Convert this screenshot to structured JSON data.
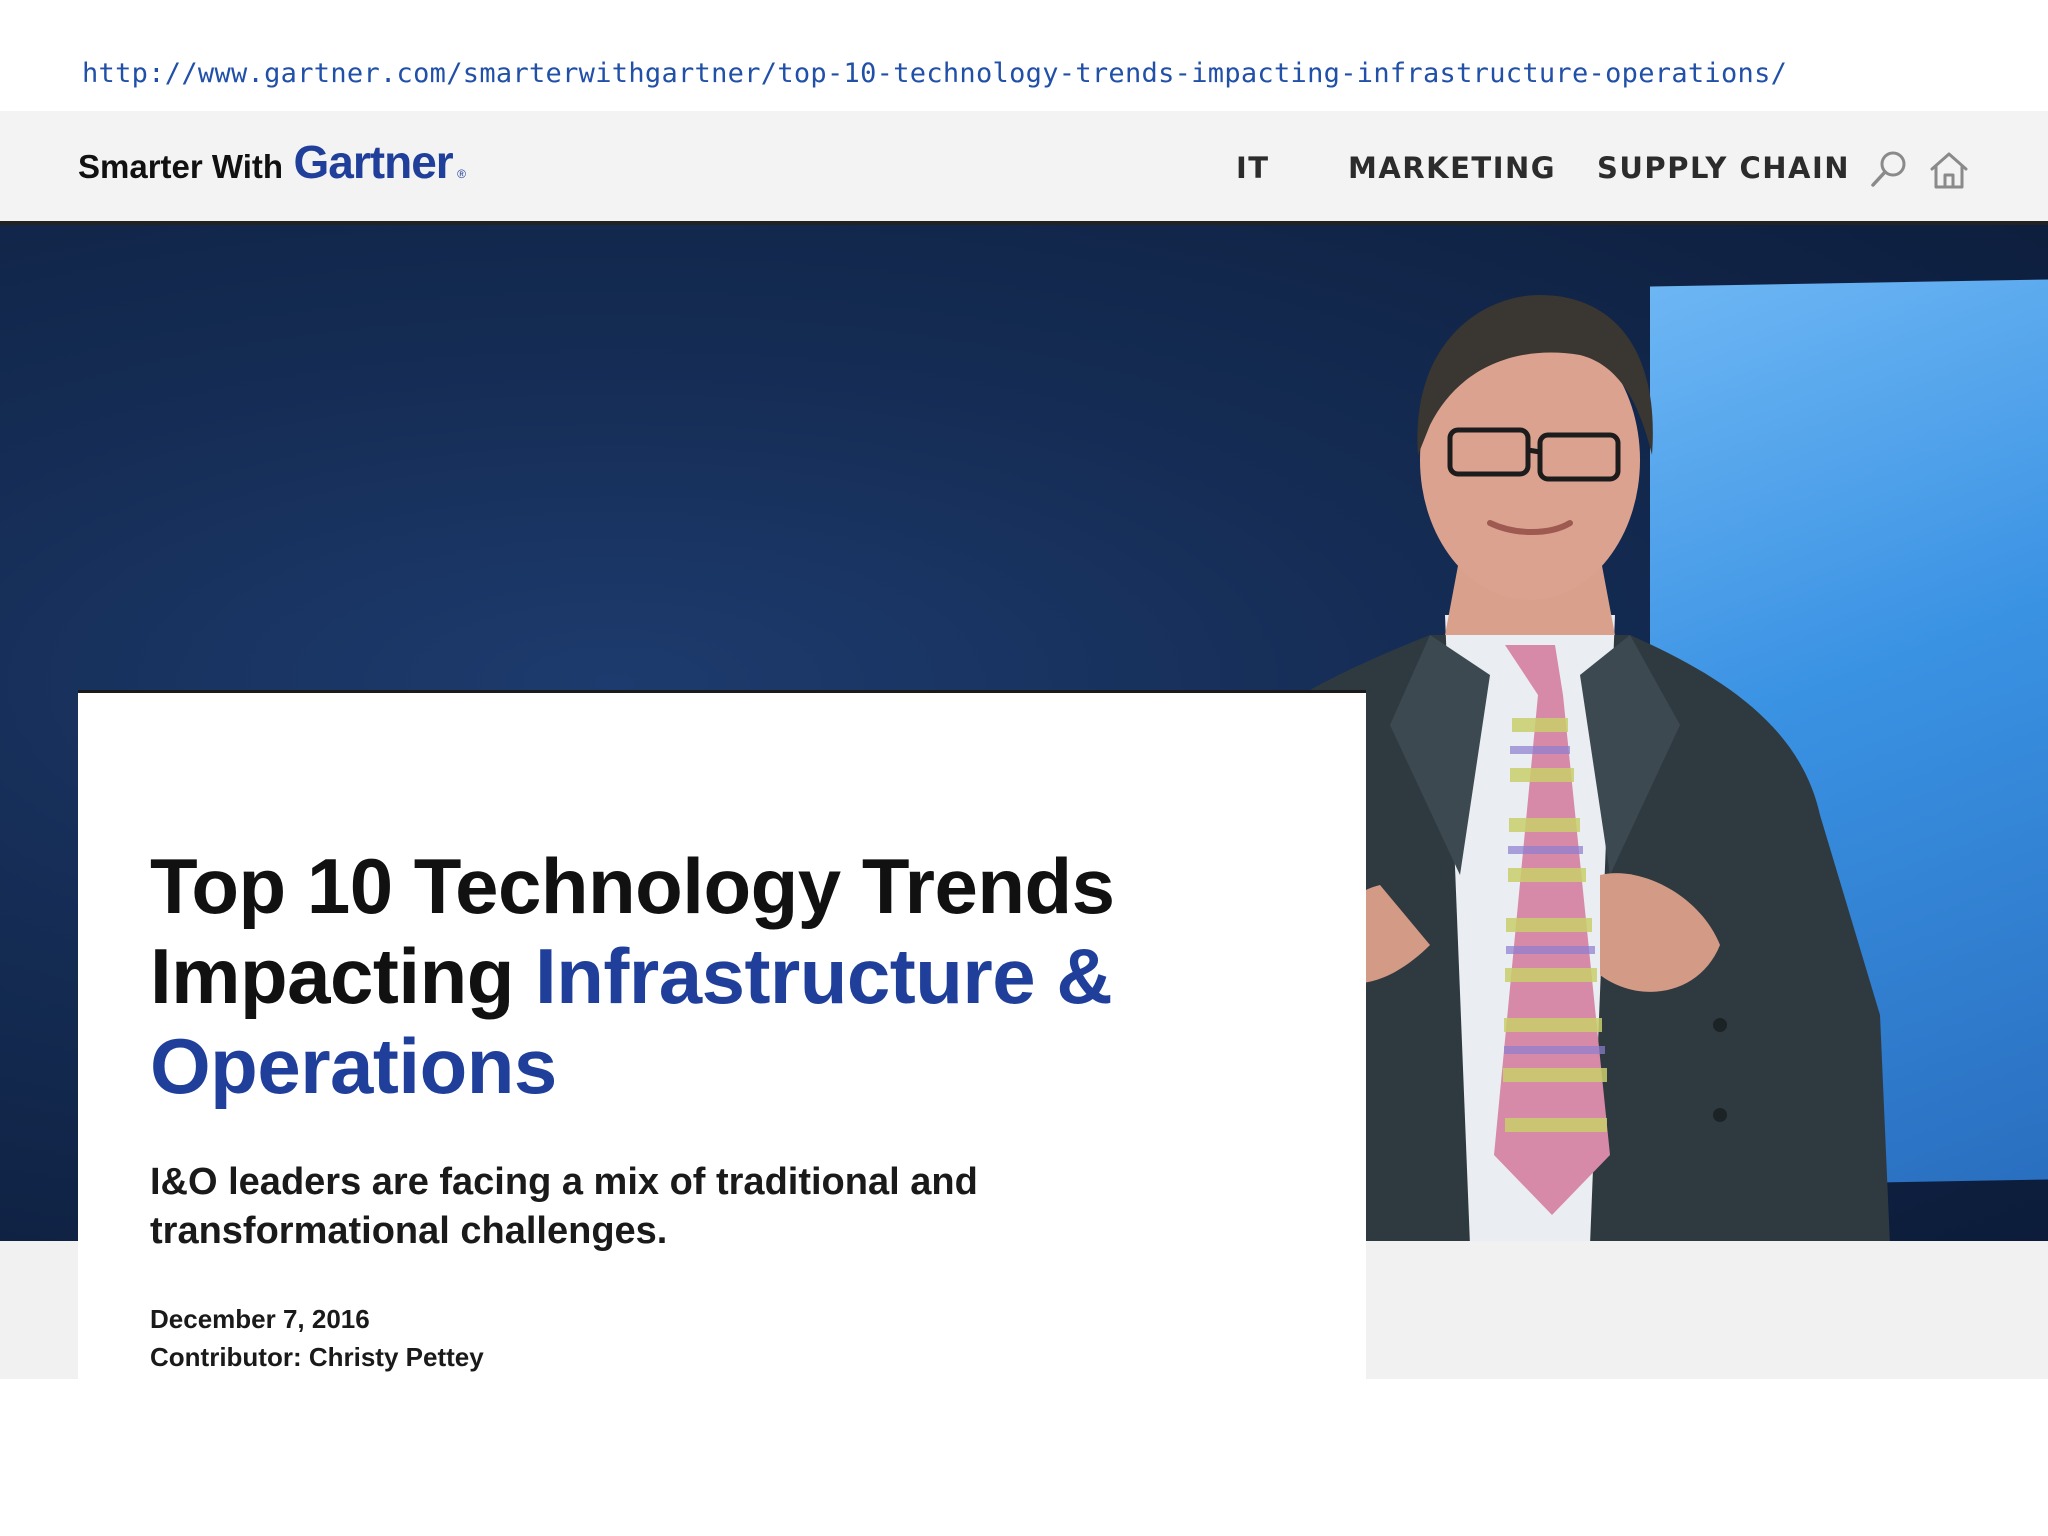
{
  "address_bar": {
    "url": "http://www.gartner.com/smarterwithgartner/top-10-technology-trends-impacting-infrastructure-operations/"
  },
  "header": {
    "logo_prefix": "Smarter With",
    "logo_brand": "Gartner",
    "logo_mark": "®",
    "nav": [
      {
        "label": "IT"
      },
      {
        "label": "MARKETING"
      },
      {
        "label": "SUPPLY CHAIN"
      }
    ],
    "icons": [
      "search-icon",
      "home-icon"
    ]
  },
  "hero": {
    "image": "speaker-photo"
  },
  "article": {
    "title_part1": "Top 10 Technology Trends Impacting ",
    "title_part2": "Infrastructure & Operations",
    "subtitle": "I&O leaders are facing a mix of traditional and transformational challenges.",
    "date": "December 7, 2016",
    "contributor": "Contributor: Christy Pettey"
  },
  "colors": {
    "brand_blue": "#1f3f9b",
    "url_blue": "#2150a8",
    "hero_navy": "#142b52",
    "screen_blue": "#3a92e3",
    "nav_background": "#f3f3f3"
  }
}
